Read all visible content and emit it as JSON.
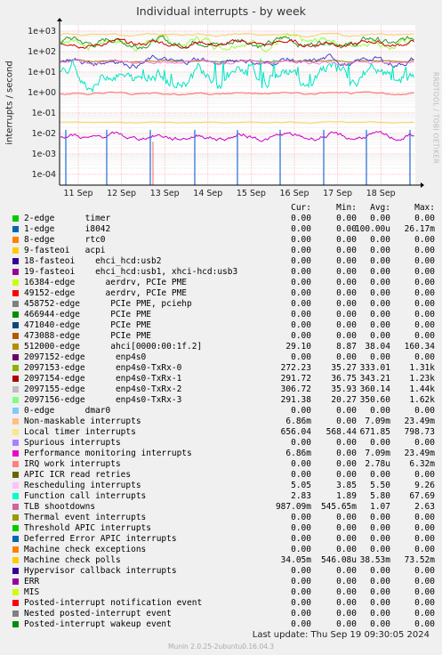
{
  "title": "Individual interrupts - by week",
  "ylabel": "interrupts / second",
  "side_label": "RRDTOOL / TOBI OETIKER",
  "chart_data": {
    "type": "line",
    "title": "Individual interrupts - by week",
    "ylabel": "interrupts / second",
    "yscale": "log",
    "ylim": [
      3e-05,
      2000
    ],
    "yticks": [
      "1e+03",
      "1e+02",
      "1e+01",
      "1e+00",
      "1e-01",
      "1e-02",
      "1e-03",
      "1e-04"
    ],
    "ytick_values": [
      1000,
      100,
      10,
      1,
      0.1,
      0.01,
      0.001,
      0.0001
    ],
    "xticks": [
      "11 Sep",
      "12 Sep",
      "13 Sep",
      "14 Sep",
      "15 Sep",
      "16 Sep",
      "17 Sep",
      "18 Sep"
    ],
    "grid": true,
    "series": [
      {
        "name": "2097156-edge enp4s0-TxRx-3",
        "color": "#99ff44",
        "level": 290,
        "spread": 0.25
      },
      {
        "name": "2097155-edge enp4s0-TxRx-2",
        "color": "#2a9a2a",
        "level": 300,
        "spread": 0.22
      },
      {
        "name": "2097154-edge enp4s0-TxRx-1",
        "color": "#cc0000",
        "level": 250,
        "spread": 0.15
      },
      {
        "name": "Local timer interrupts",
        "color": "#ffcc66",
        "level": 660,
        "spread": 0.05
      },
      {
        "name": "TLB shootdowns",
        "color": "#a8760a",
        "level": 0.9,
        "spread": 0.04,
        "plot_level": 35
      },
      {
        "name": "Rescheduling interrupts",
        "color": "#4444cc",
        "level": 5,
        "spread": 0.2,
        "plot_level": 33
      },
      {
        "name": "Function call interrupts",
        "color": "#00e6c3",
        "level": 3,
        "spread": 0.45,
        "plot_level": 6
      },
      {
        "name": "512000-edge ahci",
        "color": "#ff77cc",
        "level": 30,
        "spread": 0.1
      },
      {
        "name": "IRQ work interrupts",
        "color": "#ff6666",
        "level": 0.003,
        "spread": 0.05,
        "plot_level": 0.9
      },
      {
        "name": "Machine check polls",
        "color": "#ffd24d",
        "level": 0.035,
        "spread": 0.02
      },
      {
        "name": "Non-maskable interrupts",
        "color": "#cc00cc",
        "level": 0.0068,
        "spread": 0.15
      },
      {
        "name": "1-edge i8042",
        "color": "#1f6bd6",
        "level": 0.0001,
        "spread": 0
      }
    ]
  },
  "legend": {
    "headers": [
      "Cur:",
      "Min:",
      "Avg:",
      "Max:"
    ],
    "rows": [
      {
        "color": "#00cc00",
        "label": "2-edge      timer",
        "cur": "0.00",
        "min": "0.00",
        "avg": "0.00",
        "max": "0.00"
      },
      {
        "color": "#0066b3",
        "label": "1-edge      i8042",
        "cur": "0.00",
        "min": "0.00",
        "avg": "100.00u",
        "max": "26.17m"
      },
      {
        "color": "#ff8000",
        "label": "8-edge      rtc0",
        "cur": "0.00",
        "min": "0.00",
        "avg": "0.00",
        "max": "0.00"
      },
      {
        "color": "#ffcc00",
        "label": "9-fasteoi   acpi",
        "cur": "0.00",
        "min": "0.00",
        "avg": "0.00",
        "max": "0.00"
      },
      {
        "color": "#330099",
        "label": "18-fasteoi    ehci_hcd:usb2",
        "cur": "0.00",
        "min": "0.00",
        "avg": "0.00",
        "max": "0.00"
      },
      {
        "color": "#990099",
        "label": "19-fasteoi    ehci_hcd:usb1, xhci-hcd:usb3",
        "cur": "0.00",
        "min": "0.00",
        "avg": "0.00",
        "max": "0.00"
      },
      {
        "color": "#ccff00",
        "label": "16384-edge      aerdrv, PCIe PME",
        "cur": "0.00",
        "min": "0.00",
        "avg": "0.00",
        "max": "0.00"
      },
      {
        "color": "#ff0000",
        "label": "49152-edge      aerdrv, PCIe PME",
        "cur": "0.00",
        "min": "0.00",
        "avg": "0.00",
        "max": "0.00"
      },
      {
        "color": "#808080",
        "label": "458752-edge      PCIe PME, pciehp",
        "cur": "0.00",
        "min": "0.00",
        "avg": "0.00",
        "max": "0.00"
      },
      {
        "color": "#008f00",
        "label": "466944-edge      PCIe PME",
        "cur": "0.00",
        "min": "0.00",
        "avg": "0.00",
        "max": "0.00"
      },
      {
        "color": "#00487d",
        "label": "471040-edge      PCIe PME",
        "cur": "0.00",
        "min": "0.00",
        "avg": "0.00",
        "max": "0.00"
      },
      {
        "color": "#b35a00",
        "label": "473088-edge      PCIe PME",
        "cur": "0.00",
        "min": "0.00",
        "avg": "0.00",
        "max": "0.00"
      },
      {
        "color": "#b38f00",
        "label": "512000-edge      ahci[0000:00:1f.2]",
        "cur": "29.10",
        "min": "8.87",
        "avg": "38.04",
        "max": "160.34"
      },
      {
        "color": "#6b006b",
        "label": "2097152-edge      enp4s0",
        "cur": "0.00",
        "min": "0.00",
        "avg": "0.00",
        "max": "0.00"
      },
      {
        "color": "#8fb300",
        "label": "2097153-edge      enp4s0-TxRx-0",
        "cur": "272.23",
        "min": "35.27",
        "avg": "333.01",
        "max": "1.31k"
      },
      {
        "color": "#b30000",
        "label": "2097154-edge      enp4s0-TxRx-1",
        "cur": "291.72",
        "min": "36.75",
        "avg": "343.21",
        "max": "1.23k"
      },
      {
        "color": "#bebebe",
        "label": "2097155-edge      enp4s0-TxRx-2",
        "cur": "306.72",
        "min": "35.93",
        "avg": "360.14",
        "max": "1.44k"
      },
      {
        "color": "#80ff80",
        "label": "2097156-edge      enp4s0-TxRx-3",
        "cur": "291.38",
        "min": "20.27",
        "avg": "350.60",
        "max": "1.62k"
      },
      {
        "color": "#80c9ff",
        "label": "0-edge      dmar0",
        "cur": "0.00",
        "min": "0.00",
        "avg": "0.00",
        "max": "0.00"
      },
      {
        "color": "#ffc080",
        "label": "Non-maskable interrupts",
        "cur": "6.86m",
        "min": "0.00",
        "avg": "7.09m",
        "max": "23.49m"
      },
      {
        "color": "#ffe680",
        "label": "Local timer interrupts",
        "cur": "656.04",
        "min": "568.44",
        "avg": "671.85",
        "max": "798.73"
      },
      {
        "color": "#aa80ff",
        "label": "Spurious interrupts",
        "cur": "0.00",
        "min": "0.00",
        "avg": "0.00",
        "max": "0.00"
      },
      {
        "color": "#ee00cc",
        "label": "Performance monitoring interrupts",
        "cur": "6.86m",
        "min": "0.00",
        "avg": "7.09m",
        "max": "23.49m"
      },
      {
        "color": "#ff8080",
        "label": "IRQ work interrupts",
        "cur": "0.00",
        "min": "0.00",
        "avg": "2.78u",
        "max": "6.32m"
      },
      {
        "color": "#666600",
        "label": "APIC ICR read retries",
        "cur": "0.00",
        "min": "0.00",
        "avg": "0.00",
        "max": "0.00"
      },
      {
        "color": "#ffbfff",
        "label": "Rescheduling interrupts",
        "cur": "5.05",
        "min": "3.85",
        "avg": "5.50",
        "max": "9.26"
      },
      {
        "color": "#00ffcc",
        "label": "Function call interrupts",
        "cur": "2.83",
        "min": "1.89",
        "avg": "5.80",
        "max": "67.69"
      },
      {
        "color": "#cc6699",
        "label": "TLB shootdowns",
        "cur": "987.09m",
        "min": "545.65m",
        "avg": "1.07",
        "max": "2.63"
      },
      {
        "color": "#999900",
        "label": "Thermal event interrupts",
        "cur": "0.00",
        "min": "0.00",
        "avg": "0.00",
        "max": "0.00"
      },
      {
        "color": "#00cc00",
        "label": "Threshold APIC interrupts",
        "cur": "0.00",
        "min": "0.00",
        "avg": "0.00",
        "max": "0.00"
      },
      {
        "color": "#0066b3",
        "label": "Deferred Error APIC interrupts",
        "cur": "0.00",
        "min": "0.00",
        "avg": "0.00",
        "max": "0.00"
      },
      {
        "color": "#ff8000",
        "label": "Machine check exceptions",
        "cur": "0.00",
        "min": "0.00",
        "avg": "0.00",
        "max": "0.00"
      },
      {
        "color": "#ffcc00",
        "label": "Machine check polls",
        "cur": "34.05m",
        "min": "546.08u",
        "avg": "38.53m",
        "max": "73.52m"
      },
      {
        "color": "#330099",
        "label": "Hypervisor callback interrupts",
        "cur": "0.00",
        "min": "0.00",
        "avg": "0.00",
        "max": "0.00"
      },
      {
        "color": "#990099",
        "label": "ERR",
        "cur": "0.00",
        "min": "0.00",
        "avg": "0.00",
        "max": "0.00"
      },
      {
        "color": "#ccff00",
        "label": "MIS",
        "cur": "0.00",
        "min": "0.00",
        "avg": "0.00",
        "max": "0.00"
      },
      {
        "color": "#ff0000",
        "label": "Posted-interrupt notification event",
        "cur": "0.00",
        "min": "0.00",
        "avg": "0.00",
        "max": "0.00"
      },
      {
        "color": "#808080",
        "label": "Nested posted-interrupt event",
        "cur": "0.00",
        "min": "0.00",
        "avg": "0.00",
        "max": "0.00"
      },
      {
        "color": "#008f00",
        "label": "Posted-interrupt wakeup event",
        "cur": "0.00",
        "min": "0.00",
        "avg": "0.00",
        "max": "0.00"
      }
    ]
  },
  "last_update": "Last update:  Thu Sep 19 09:30:05 2024",
  "footer": "Munin 2.0.25-2ubuntu0.16.04.3"
}
